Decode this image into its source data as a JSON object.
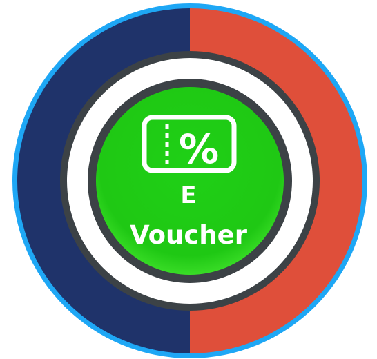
{
  "badge": {
    "label_line1": "E",
    "label_line2": "Voucher",
    "icon": "voucher-percent-icon",
    "colors": {
      "outer_ring": "#1ea7f5",
      "left_half": "#1f336a",
      "right_half": "#df4f3a",
      "inner_ring": "#3c4246",
      "center": "#1fd016",
      "center_highlight": "#3ee02a",
      "text": "#ffffff"
    }
  }
}
